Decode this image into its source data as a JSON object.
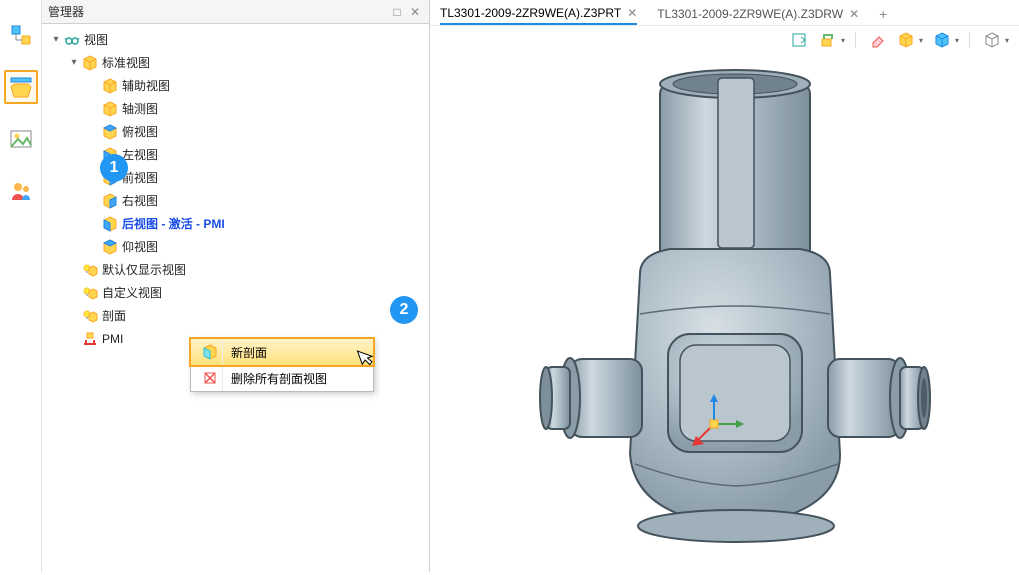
{
  "panel": {
    "title": "管理器",
    "controls": {
      "minimize": "□",
      "close": "✕"
    }
  },
  "tree": {
    "root_label": "视图",
    "standard_views": {
      "label": "标准视图",
      "children": {
        "aux": "辅助视图",
        "axo": "轴测图",
        "top": "俯视图",
        "left": "左视图",
        "front": "前视图",
        "right": "右视图",
        "back_active": "后视图 - 激活 - PMI",
        "bottom": "仰视图"
      }
    },
    "default_show": "默认仅显示视图",
    "custom_view": "自定义视图",
    "section_view": "剖面",
    "pmi": "PMI"
  },
  "context_menu": {
    "new_section": "新剖面",
    "delete_all": "删除所有剖面视图"
  },
  "badges": {
    "one": "1",
    "two": "2"
  },
  "tabs": {
    "prt": "TL3301-2009-2ZR9WE(A).Z3PRT",
    "drw": "TL3301-2009-2ZR9WE(A).Z3DRW"
  },
  "glyphs": {
    "expand": "▾",
    "collapse": "▸",
    "close_x": "✕",
    "plus": "+",
    "dropdown": "▾"
  }
}
